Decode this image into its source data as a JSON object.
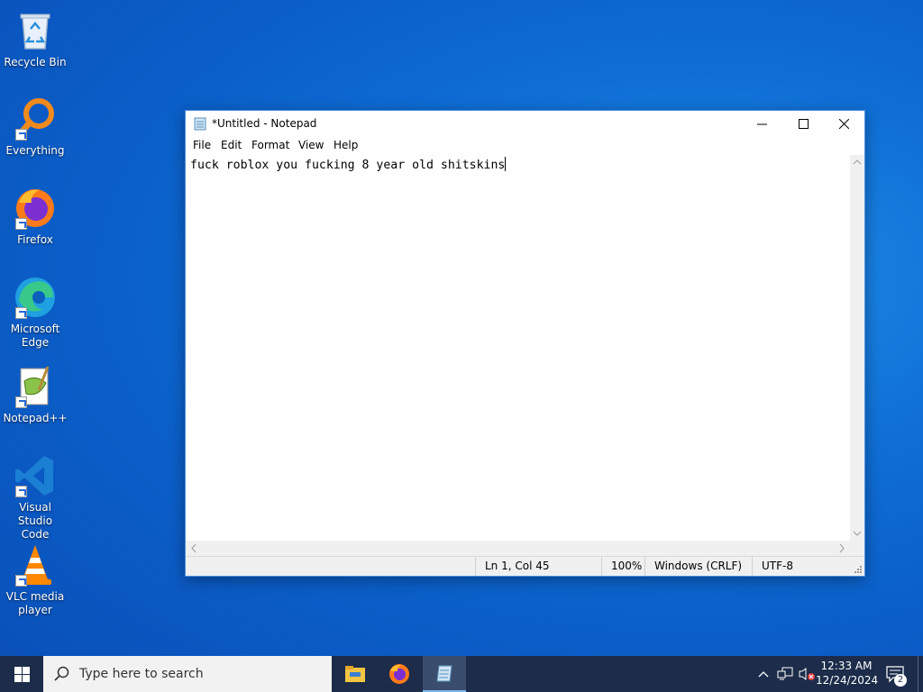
{
  "desktop": {
    "icons": [
      {
        "label_line1": "Recycle Bin",
        "label_line2": ""
      },
      {
        "label_line1": "Everything",
        "label_line2": ""
      },
      {
        "label_line1": "Firefox",
        "label_line2": ""
      },
      {
        "label_line1": "Microsoft",
        "label_line2": "Edge"
      },
      {
        "label_line1": "Notepad++",
        "label_line2": ""
      },
      {
        "label_line1": "Visual Studio",
        "label_line2": "Code"
      },
      {
        "label_line1": "VLC media",
        "label_line2": "player"
      }
    ]
  },
  "notepad": {
    "title": "*Untitled - Notepad",
    "menu": [
      "File",
      "Edit",
      "Format",
      "View",
      "Help"
    ],
    "content": "fuck roblox you fucking 8 year old shitskins",
    "status": {
      "position": "Ln 1, Col 45",
      "zoom": "100%",
      "line_ending": "Windows (CRLF)",
      "encoding": "UTF-8"
    }
  },
  "taskbar": {
    "search_placeholder": "Type here to search",
    "clock_time": "12:33 AM",
    "clock_date": "12/24/2024",
    "notification_count": "2"
  },
  "colors": {
    "desktop_blue": "#0f6ed6",
    "taskbar": "#1c2c4a",
    "window_border": "#4a90d9"
  }
}
